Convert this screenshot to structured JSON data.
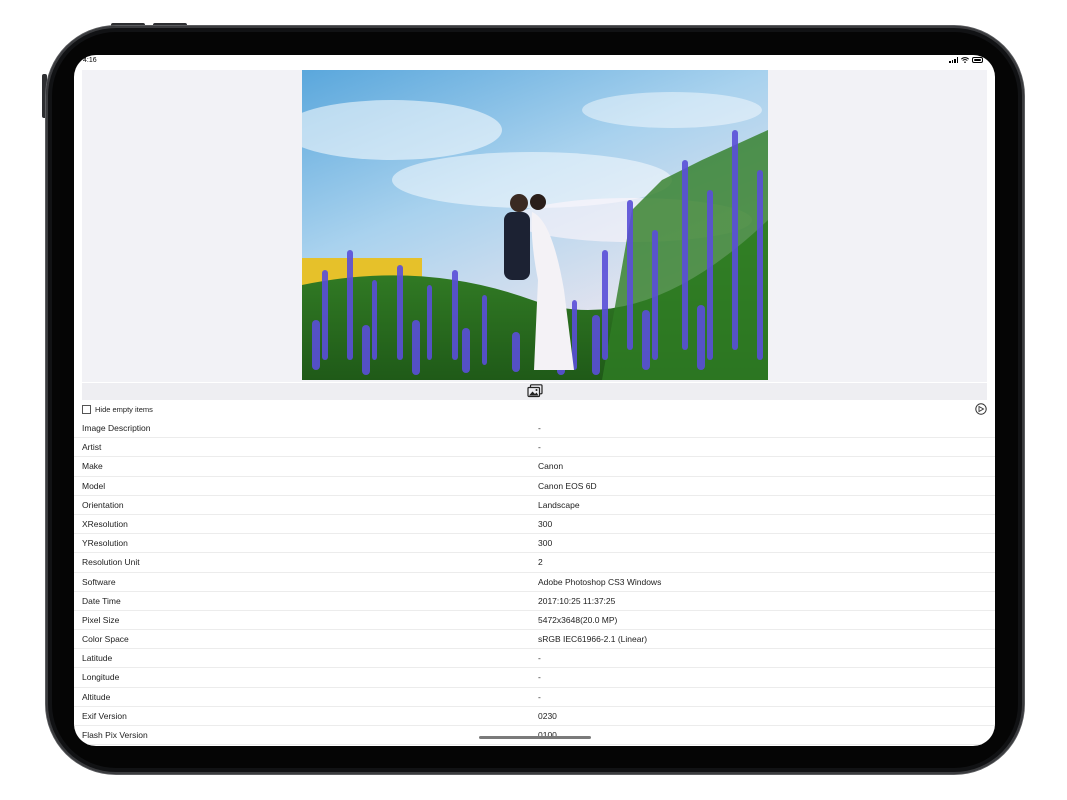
{
  "status_bar": {
    "time": "4:16"
  },
  "toolbar": {
    "gallery_icon": "photo-gallery-icon"
  },
  "options": {
    "hide_empty_label": "Hide empty items",
    "hide_empty_checked": false,
    "share_icon": "share-icon"
  },
  "exif": {
    "rows": [
      {
        "key": "Image Description",
        "value": "-"
      },
      {
        "key": "Artist",
        "value": "-"
      },
      {
        "key": "Make",
        "value": "Canon"
      },
      {
        "key": "Model",
        "value": "Canon EOS 6D"
      },
      {
        "key": "Orientation",
        "value": "Landscape"
      },
      {
        "key": "XResolution",
        "value": "300"
      },
      {
        "key": "YResolution",
        "value": "300"
      },
      {
        "key": "Resolution Unit",
        "value": "2"
      },
      {
        "key": "Software",
        "value": "Adobe Photoshop CS3 Windows"
      },
      {
        "key": "Date Time",
        "value": "2017:10:25 11:37:25"
      },
      {
        "key": "Pixel Size",
        "value": "5472x3648(20.0 MP)"
      },
      {
        "key": "Color Space",
        "value": "sRGB IEC61966-2.1 (Linear)"
      },
      {
        "key": "Latitude",
        "value": "-"
      },
      {
        "key": "Longitude",
        "value": "-"
      },
      {
        "key": "Altitude",
        "value": "-"
      },
      {
        "key": "Exif Version",
        "value": "0230"
      },
      {
        "key": "Flash Pix Version",
        "value": "0100"
      }
    ]
  },
  "colors": {
    "device_frame": "#111214",
    "photo_background": "#f2f2f6",
    "row_divider": "#ececec"
  }
}
